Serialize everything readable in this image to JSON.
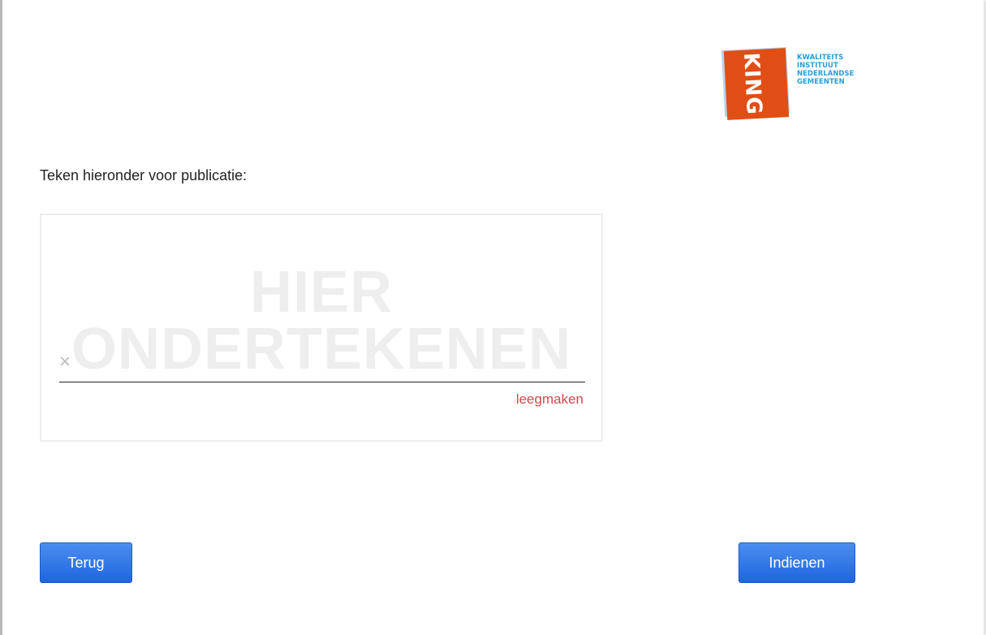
{
  "logo": {
    "mark": "KING",
    "lines": [
      "KWALITEITS",
      "INSTITUUT",
      "NEDERLANDSE",
      "GEMEENTEN"
    ],
    "colors": {
      "orange": "#e04e16",
      "blue": "#2a9ed8"
    }
  },
  "instruction": "Teken hieronder voor publicatie:",
  "signature_pad": {
    "watermark_line1": "HIER",
    "watermark_line2": "ONDERTEKENEN",
    "x_mark": "×",
    "clear_label": "leegmaken"
  },
  "buttons": {
    "back_label": "Terug",
    "submit_label": "Indienen",
    "color": "#1f65de"
  }
}
